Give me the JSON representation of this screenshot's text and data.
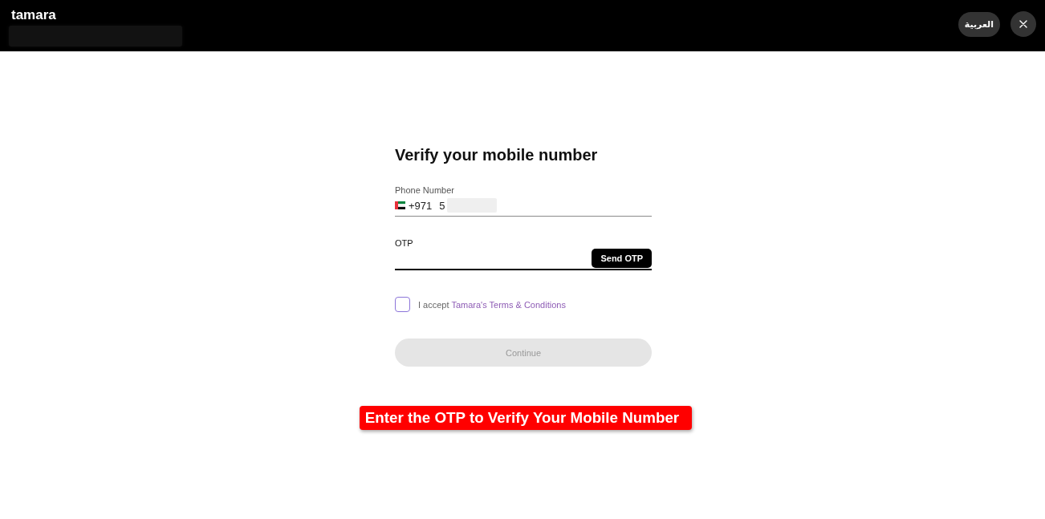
{
  "header": {
    "logo": "tamara",
    "language_button": "العربية"
  },
  "form": {
    "title": "Verify your mobile number",
    "phone": {
      "label": "Phone Number",
      "country_code": "+971",
      "value": "5"
    },
    "otp": {
      "label": "OTP",
      "send_button": "Send OTP"
    },
    "terms": {
      "checked": false,
      "text": "I accept",
      "link": "Tamara's Terms & Conditions"
    },
    "continue_button": {
      "label": "Continue",
      "disabled": true
    }
  },
  "annotation": {
    "text": "Enter the OTP to Verify Your Mobile Number"
  }
}
